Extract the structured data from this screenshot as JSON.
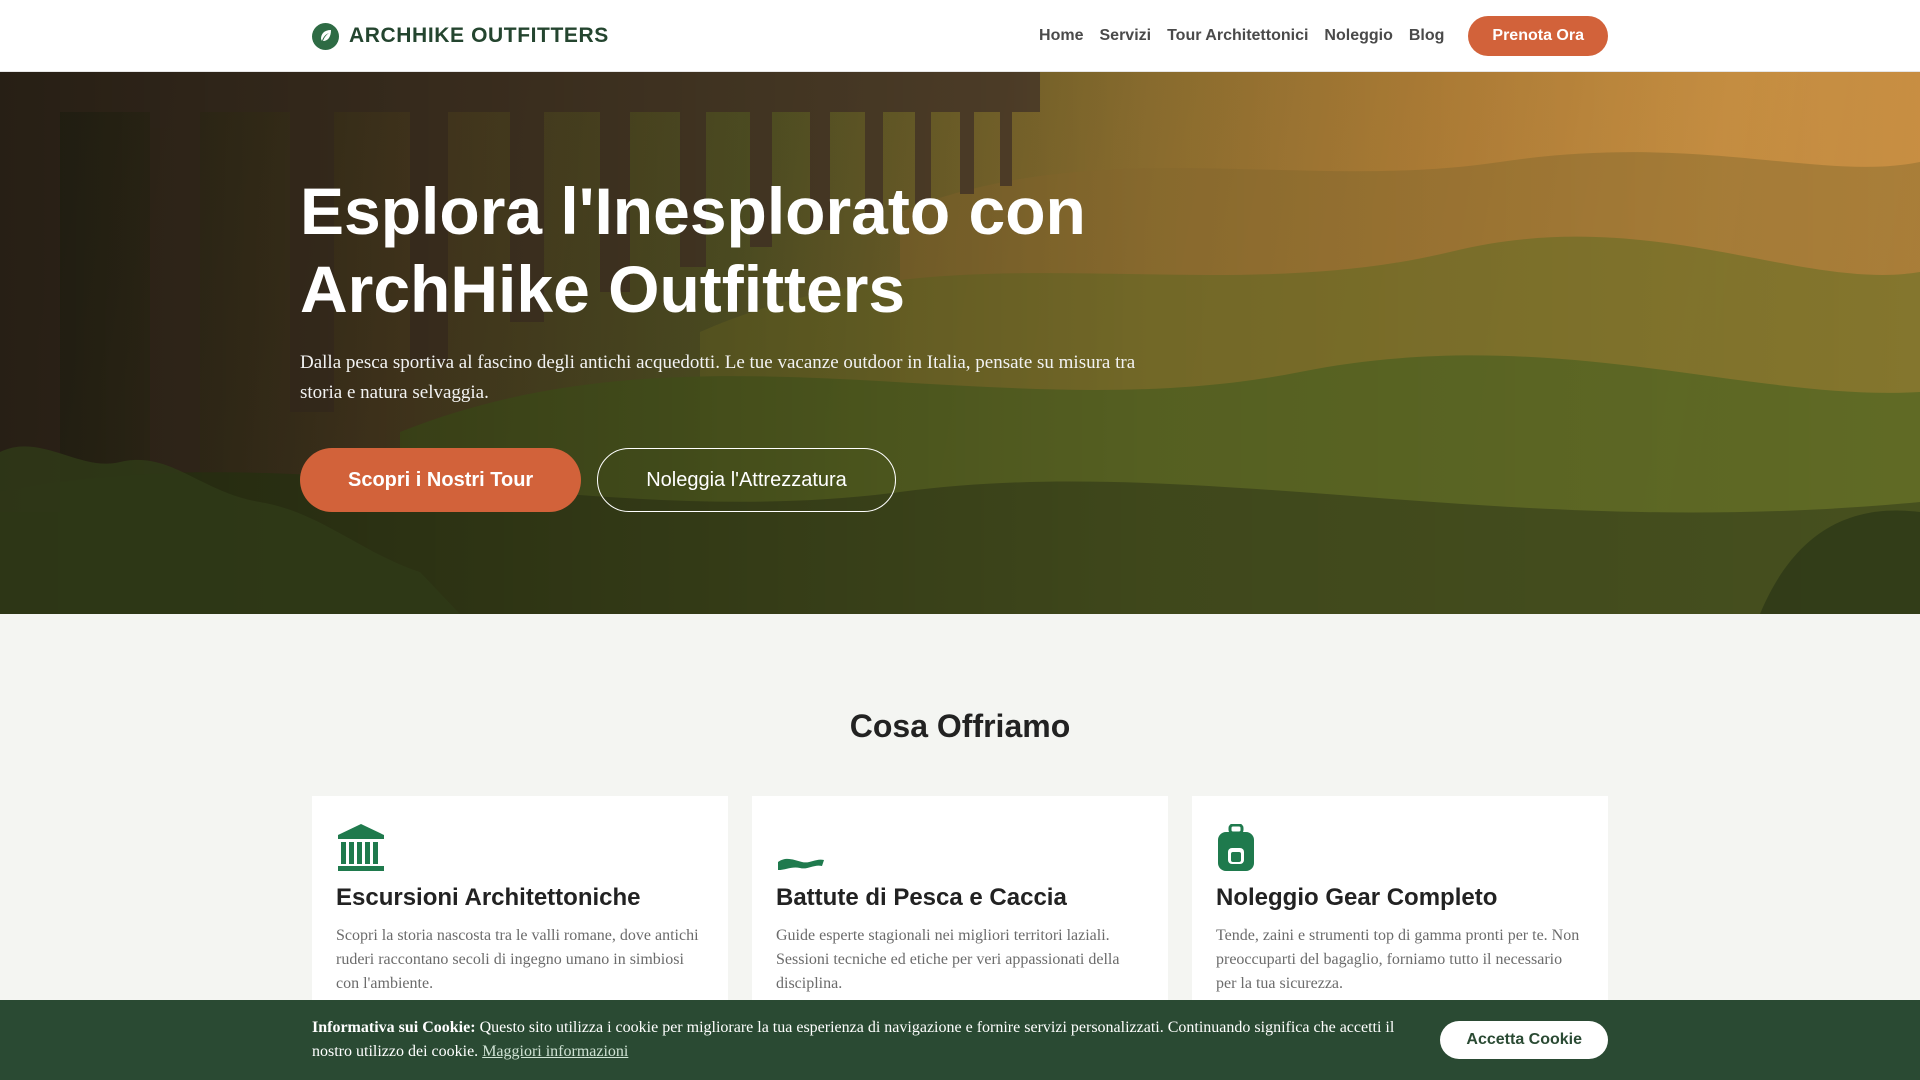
{
  "brand": {
    "name": "ARCHHIKE OUTFITTERS",
    "icon": "leaf-icon"
  },
  "nav": {
    "items": [
      "Home",
      "Servizi",
      "Tour Architettonici",
      "Noleggio",
      "Blog"
    ],
    "cta": "Prenota Ora"
  },
  "hero": {
    "title": "Esplora l'Inesplorato con ArchHike Outfitters",
    "subtitle": "Dalla pesca sportiva al fascino degli antichi acquedotti. Le tue vacanze outdoor in Italia, pensate su misura tra storia e natura selvaggia.",
    "primary_button": "Scopri i Nostri Tour",
    "secondary_button": "Noleggia l'Attrezzatura"
  },
  "services": {
    "title": "Cosa Offriamo",
    "cards": [
      {
        "icon": "landmark-icon",
        "title": "Escursioni Architettoniche",
        "text": "Scopri la storia nascosta tra le valli romane, dove antichi ruderi raccontano secoli di ingegno umano in simbiosi con l'ambiente."
      },
      {
        "icon": "fish-icon",
        "title": "Battute di Pesca e Caccia",
        "text": "Guide esperte stagionali nei migliori territori laziali. Sessioni tecniche ed etiche per veri appassionati della disciplina."
      },
      {
        "icon": "backpack-icon",
        "title": "Noleggio Gear Completo",
        "text": "Tende, zaini e strumenti top di gamma pronti per te. Non preoccuparti del bagaglio, forniamo tutto il necessario per la tua sicurezza."
      }
    ]
  },
  "cookie": {
    "label": "Informativa sui Cookie:",
    "text": "Questo sito utilizza i cookie per migliorare la tua esperienza di navigazione e fornire servizi personalizzati. Continuando significa che accetti il nostro utilizzo dei cookie.",
    "link": "Maggiori informazioni",
    "button": "Accetta Cookie"
  },
  "colors": {
    "accent": "#d2623a",
    "brand": "#2e6b44",
    "cookie_bg": "#2a4a33",
    "icon": "#1f7a4d"
  }
}
